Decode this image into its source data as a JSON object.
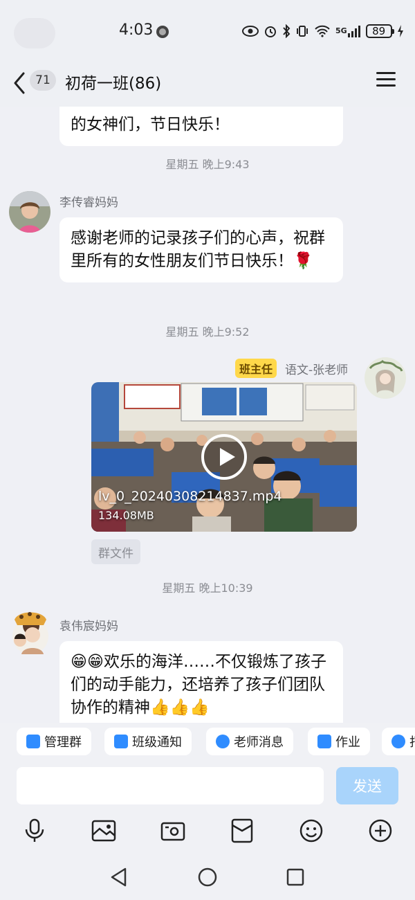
{
  "status_bar": {
    "time": "4:03",
    "network": "5G",
    "battery": "89"
  },
  "nav": {
    "unread_count": "71",
    "title": "初荷一班(86)"
  },
  "messages": [
    {
      "type": "text",
      "side": "left",
      "text": "的女神们，节日快乐！"
    },
    {
      "type": "timestamp",
      "text": "星期五 晚上9:43"
    },
    {
      "type": "text",
      "side": "left",
      "sender": "李传睿妈妈",
      "text": "感谢老师的记录孩子们的心声，祝群里所有的女性朋友们节日快乐！🌹"
    },
    {
      "type": "timestamp",
      "text": "星期五 晚上9:52"
    },
    {
      "type": "video",
      "side": "right",
      "badge": "班主任",
      "sender": "语文-张老师",
      "file_name": "lv_0_20240308214837.mp4",
      "file_size": "134.08MB",
      "tag": "群文件"
    },
    {
      "type": "timestamp",
      "text": "星期五 晚上10:39"
    },
    {
      "type": "text",
      "side": "left",
      "sender": "袁伟宸妈妈",
      "text": "😁😁欢乐的海洋……不仅锻炼了孩子们的动手能力，还培养了孩子们团队协作的精神👍👍👍"
    }
  ],
  "quick_actions": [
    {
      "label": "管理群",
      "icon": "manage-group-icon"
    },
    {
      "label": "班级通知",
      "icon": "notice-icon"
    },
    {
      "label": "老师消息",
      "icon": "teacher-icon"
    },
    {
      "label": "作业",
      "icon": "homework-icon"
    },
    {
      "label": "打",
      "icon": "checkin-icon"
    }
  ],
  "input": {
    "placeholder": "",
    "send_label": "发送"
  },
  "toolbar": [
    "microphone-icon",
    "image-icon",
    "camera-icon",
    "red-packet-icon",
    "emoji-icon",
    "plus-icon"
  ],
  "colors": {
    "accent": "#2f8cff",
    "send_disabled": "#a9d4fb",
    "badge": "#ffd84a",
    "background": "#eff0f5"
  }
}
